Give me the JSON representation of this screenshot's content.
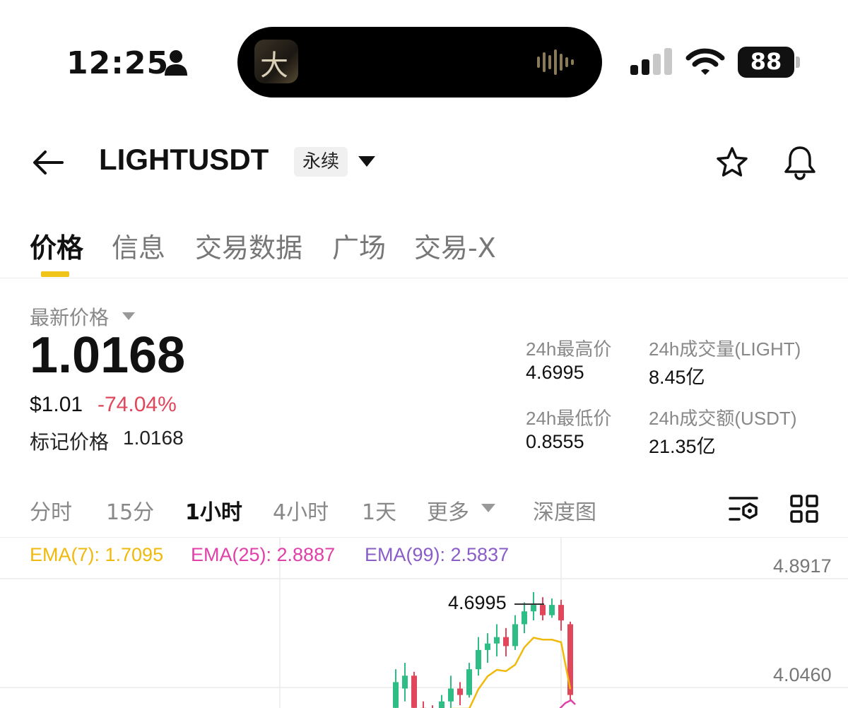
{
  "status_bar": {
    "time": "12:25",
    "battery": "88"
  },
  "header": {
    "symbol": "LIGHTUSDT",
    "contract_type": "永续"
  },
  "tabs": [
    {
      "label": "价格",
      "active": true
    },
    {
      "label": "信息",
      "active": false
    },
    {
      "label": "交易数据",
      "active": false
    },
    {
      "label": "广场",
      "active": false
    },
    {
      "label": "交易-X",
      "active": false
    }
  ],
  "price": {
    "latest_label": "最新价格",
    "last": "1.0168",
    "usd": "$1.01",
    "change": "-74.04%",
    "mark_label": "标记价格",
    "mark_value": "1.0168"
  },
  "stats": {
    "high_label": "24h最高价",
    "high_value": "4.6995",
    "low_label": "24h最低价",
    "low_value": "0.8555",
    "volume_label": "24h成交量(LIGHT)",
    "volume_value": "8.45亿",
    "turnover_label": "24h成交额(USDT)",
    "turnover_value": "21.35亿"
  },
  "intervals": [
    {
      "label": "分时",
      "active": false
    },
    {
      "label": "15分",
      "active": false
    },
    {
      "label": "1小时",
      "active": true
    },
    {
      "label": "4小时",
      "active": false
    },
    {
      "label": "1天",
      "active": false
    },
    {
      "label": "更多",
      "active": false
    },
    {
      "label": "深度图",
      "active": false
    }
  ],
  "chart": {
    "ema7": "EMA(7): 1.7095",
    "ema25": "EMA(25): 2.8887",
    "ema99": "EMA(99): 2.5837",
    "y_labels": [
      "4.8917",
      "4.0460"
    ],
    "high_marker": "4.6995"
  },
  "colors": {
    "up": "#2ebd85",
    "down": "#e0475a",
    "ema7": "#f0b90b",
    "ema25": "#e040a8",
    "ema99": "#8a5cc8",
    "accent": "#f0c419"
  },
  "chart_data": {
    "type": "candlestick",
    "title": "",
    "yaxis_labels": [
      4.8917,
      4.046
    ],
    "annotations": [
      {
        "text": "4.6995",
        "kind": "high"
      }
    ],
    "series": [
      {
        "name": "EMA(7)",
        "last": 1.7095
      },
      {
        "name": "EMA(25)",
        "last": 2.8887
      },
      {
        "name": "EMA(99)",
        "last": 2.5837
      }
    ],
    "candles": [
      {
        "o": 3.8,
        "c": 4.0,
        "h": 4.1,
        "l": 3.7
      },
      {
        "o": 3.95,
        "c": 4.05,
        "h": 4.15,
        "l": 3.85
      },
      {
        "o": 4.05,
        "c": 3.8,
        "h": 4.08,
        "l": 3.7
      },
      {
        "o": 3.8,
        "c": 3.75,
        "h": 3.85,
        "l": 3.65
      },
      {
        "o": 3.75,
        "c": 3.7,
        "h": 3.82,
        "l": 3.62
      },
      {
        "o": 3.7,
        "c": 3.85,
        "h": 3.9,
        "l": 3.65
      },
      {
        "o": 3.85,
        "c": 3.95,
        "h": 4.05,
        "l": 3.8
      },
      {
        "o": 3.95,
        "c": 3.9,
        "h": 4.0,
        "l": 3.82
      },
      {
        "o": 3.9,
        "c": 4.1,
        "h": 4.15,
        "l": 3.88
      },
      {
        "o": 4.1,
        "c": 4.25,
        "h": 4.35,
        "l": 4.05
      },
      {
        "o": 4.25,
        "c": 4.3,
        "h": 4.38,
        "l": 4.15
      },
      {
        "o": 4.3,
        "c": 4.35,
        "h": 4.45,
        "l": 4.2
      },
      {
        "o": 4.35,
        "c": 4.28,
        "h": 4.42,
        "l": 4.2
      },
      {
        "o": 4.28,
        "c": 4.45,
        "h": 4.52,
        "l": 4.25
      },
      {
        "o": 4.45,
        "c": 4.55,
        "h": 4.62,
        "l": 4.38
      },
      {
        "o": 4.55,
        "c": 4.6,
        "h": 4.6995,
        "l": 4.48
      },
      {
        "o": 4.6,
        "c": 4.52,
        "h": 4.66,
        "l": 4.48
      },
      {
        "o": 4.52,
        "c": 4.6,
        "h": 4.65,
        "l": 4.5
      },
      {
        "o": 4.6,
        "c": 4.48,
        "h": 4.64,
        "l": 4.4
      },
      {
        "o": 4.45,
        "c": 3.9,
        "h": 4.47,
        "l": 3.85
      }
    ]
  }
}
